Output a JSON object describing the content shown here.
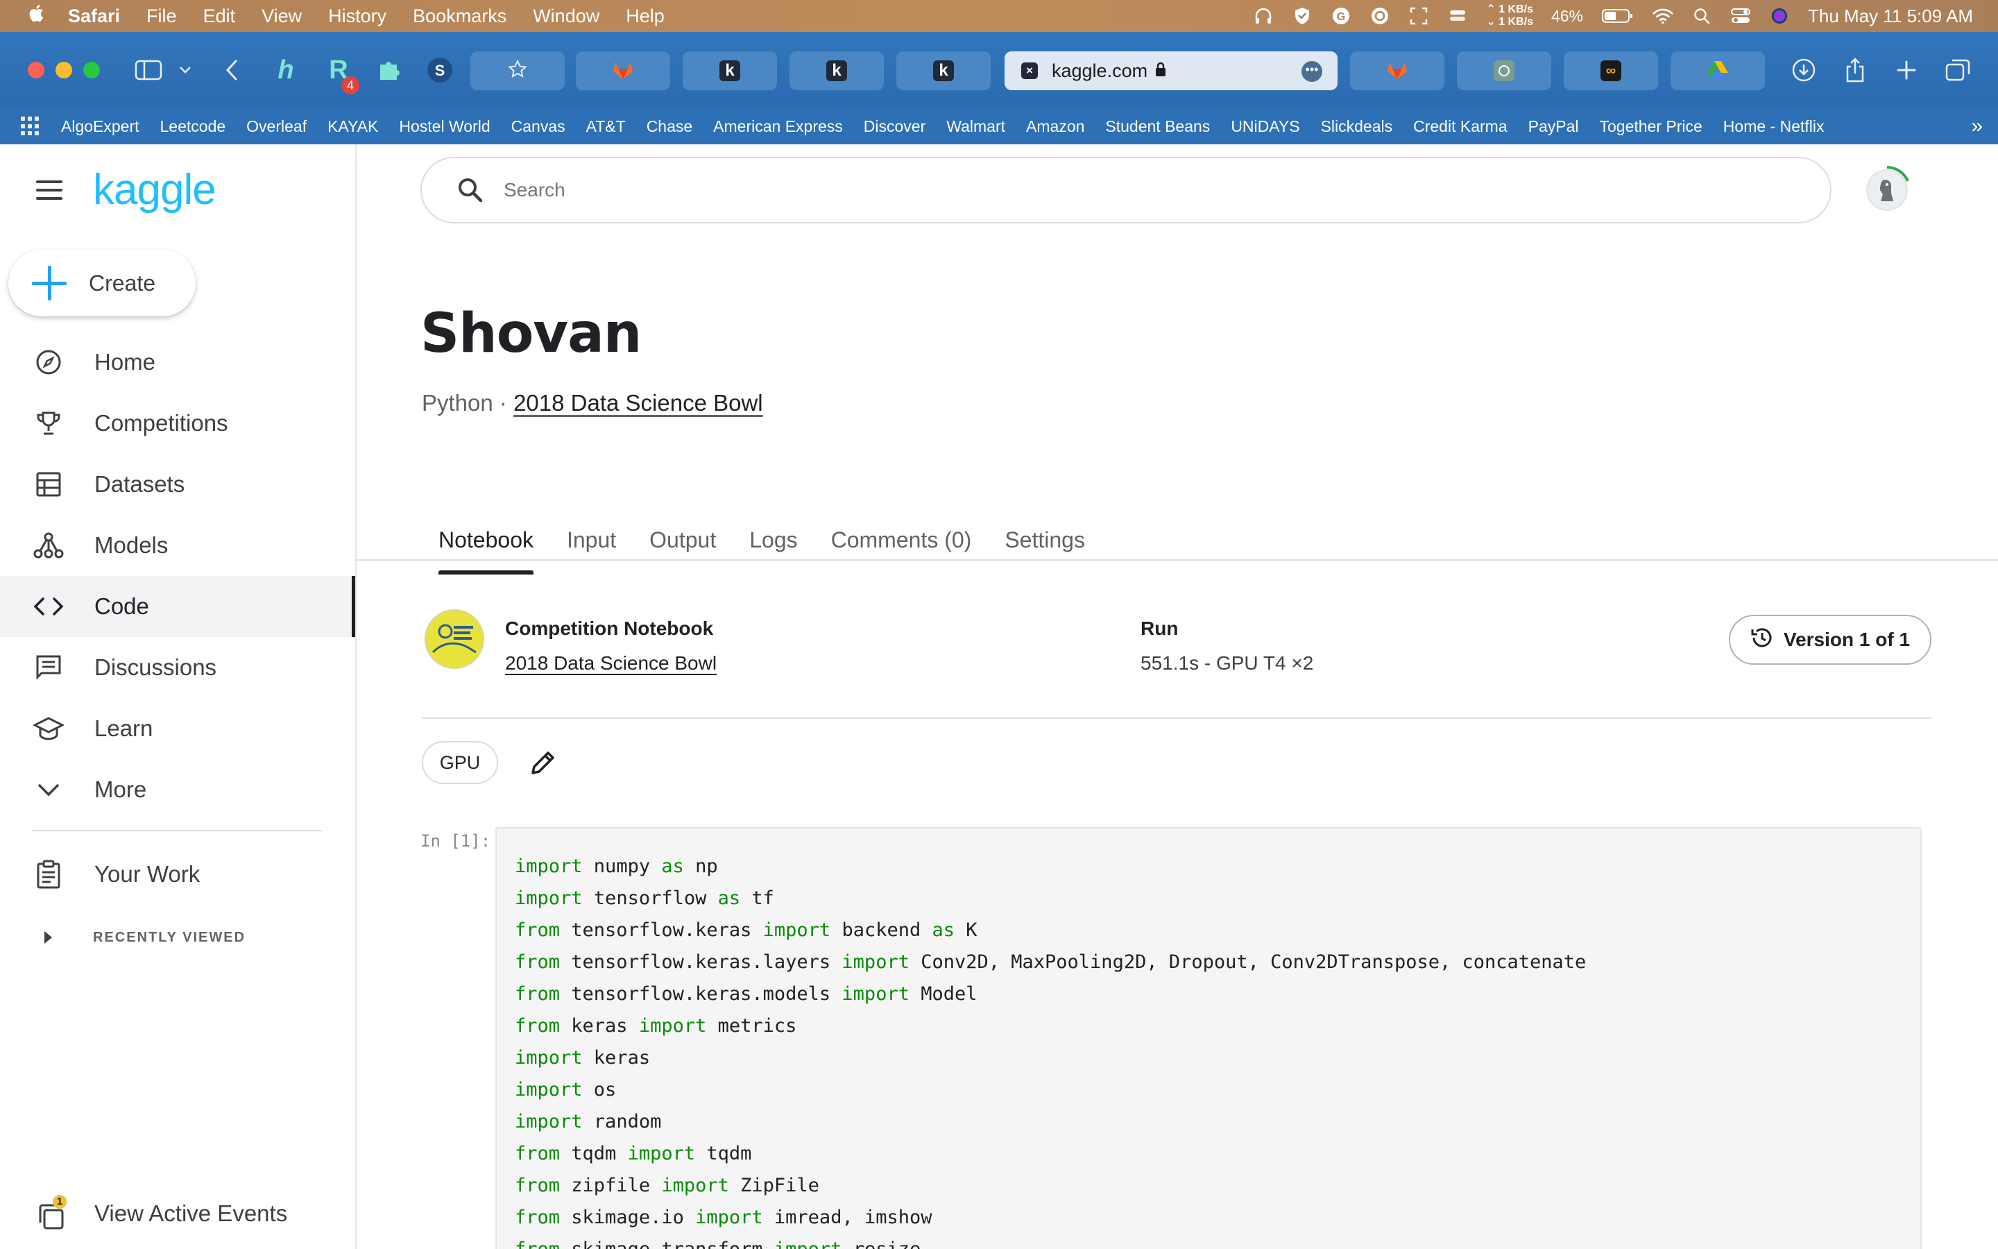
{
  "menubar": {
    "apple": "",
    "app_name": "Safari",
    "menus": [
      "File",
      "Edit",
      "View",
      "History",
      "Bookmarks",
      "Window",
      "Help"
    ],
    "net_up": "1 KB/s",
    "net_down": "1 KB/s",
    "battery": "46%",
    "datetime": "Thu May 11  5:09 AM"
  },
  "browser": {
    "address": "kaggle.com",
    "tab_badge": "4",
    "bookmarks": [
      "AlgoExpert",
      "Leetcode",
      "Overleaf",
      "KAYAK",
      "Hostel World",
      "Canvas",
      "AT&T",
      "Chase",
      "American Express",
      "Discover",
      "Walmart",
      "Amazon",
      "Student Beans",
      "UNiDAYS",
      "Slickdeals",
      "Credit Karma",
      "PayPal",
      "Together Price",
      "Home - Netflix"
    ],
    "more_bookmarks": "»"
  },
  "sidebar": {
    "logo": "kaggle",
    "create": "Create",
    "items": [
      {
        "label": "Home",
        "icon": "compass-icon"
      },
      {
        "label": "Competitions",
        "icon": "trophy-icon"
      },
      {
        "label": "Datasets",
        "icon": "table-icon"
      },
      {
        "label": "Models",
        "icon": "models-icon"
      },
      {
        "label": "Code",
        "icon": "code-icon",
        "active": true
      },
      {
        "label": "Discussions",
        "icon": "discussion-icon"
      },
      {
        "label": "Learn",
        "icon": "school-icon"
      },
      {
        "label": "More",
        "icon": "chevron-down-icon"
      }
    ],
    "your_work": "Your Work",
    "recently_viewed": "RECENTLY VIEWED",
    "view_active_events": "View Active Events",
    "events_badge": "1"
  },
  "search": {
    "placeholder": "Search"
  },
  "notebook": {
    "title": "Shovan",
    "language": "Python",
    "separator": " · ",
    "competition_link": "2018 Data Science Bowl",
    "tabs": [
      "Notebook",
      "Input",
      "Output",
      "Logs",
      "Comments (0)",
      "Settings"
    ],
    "active_tab": "Notebook",
    "info": {
      "competition_label": "Competition Notebook",
      "competition_value": "2018 Data Science Bowl",
      "run_label": "Run",
      "run_value": "551.1s - GPU T4 ×2"
    },
    "version_button": "Version 1 of 1",
    "accelerator": "GPU",
    "cell_prompt": "In [1]:",
    "code_lines": [
      [
        {
          "k": "import"
        },
        {
          "t": " numpy "
        },
        {
          "k": "as"
        },
        {
          "t": " np"
        }
      ],
      [
        {
          "k": "import"
        },
        {
          "t": " tensorflow "
        },
        {
          "k": "as"
        },
        {
          "t": " tf"
        }
      ],
      [
        {
          "k": "from"
        },
        {
          "t": " tensorflow.keras "
        },
        {
          "k": "import"
        },
        {
          "t": " backend "
        },
        {
          "k": "as"
        },
        {
          "t": " K"
        }
      ],
      [
        {
          "k": "from"
        },
        {
          "t": " tensorflow.keras.layers "
        },
        {
          "k": "import"
        },
        {
          "t": " Conv2D, MaxPooling2D, Dropout, Conv2DTranspose, concatenate"
        }
      ],
      [
        {
          "k": "from"
        },
        {
          "t": " tensorflow.keras.models "
        },
        {
          "k": "import"
        },
        {
          "t": " Model"
        }
      ],
      [
        {
          "k": "from"
        },
        {
          "t": " keras "
        },
        {
          "k": "import"
        },
        {
          "t": " metrics"
        }
      ],
      [
        {
          "k": "import"
        },
        {
          "t": " keras"
        }
      ],
      [
        {
          "k": "import"
        },
        {
          "t": " os"
        }
      ],
      [
        {
          "k": "import"
        },
        {
          "t": " random"
        }
      ],
      [
        {
          "k": "from"
        },
        {
          "t": " tqdm "
        },
        {
          "k": "import"
        },
        {
          "t": " tqdm"
        }
      ],
      [
        {
          "k": "from"
        },
        {
          "t": " zipfile "
        },
        {
          "k": "import"
        },
        {
          "t": " ZipFile"
        }
      ],
      [
        {
          "k": "from"
        },
        {
          "t": " skimage.io "
        },
        {
          "k": "import"
        },
        {
          "t": " imread, imshow"
        }
      ],
      [
        {
          "k": "from"
        },
        {
          "t": " skimage.transform "
        },
        {
          "k": "import"
        },
        {
          "t": " resize"
        }
      ]
    ]
  },
  "colors": {
    "kaggle_blue": "#20beff",
    "keyword_green": "#0a8a0a",
    "safari_blue": "#2d6fb3"
  }
}
